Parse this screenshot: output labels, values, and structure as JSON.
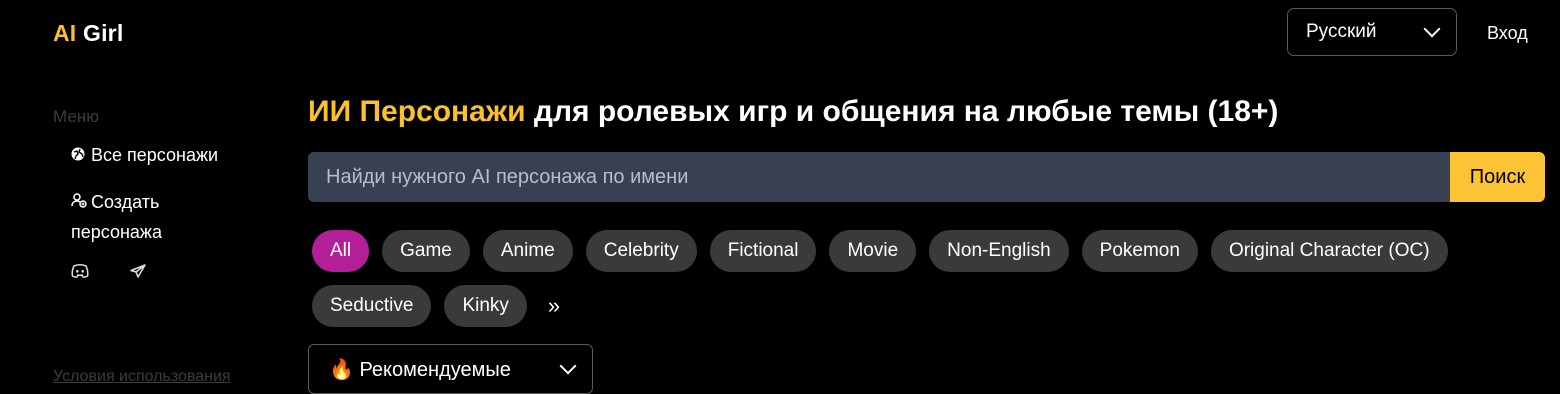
{
  "header": {
    "logo_accent": "AI",
    "logo_rest": " Girl",
    "language": "Русский",
    "login_label": "Вход"
  },
  "sidebar": {
    "menu_label": "Меню",
    "items": [
      {
        "label": "Все персонажи",
        "icon": "globe-icon"
      },
      {
        "label": "Создать персонажа",
        "icon": "user-add-icon"
      }
    ],
    "socials": [
      "discord-icon",
      "telegram-icon"
    ],
    "terms_label": "Условия использования"
  },
  "main": {
    "headline_accent": "ИИ Персонажи",
    "headline_rest": " для ролевых игр и общения на любые темы (18+)",
    "search_placeholder": "Найди нужного AI персонажа по имени",
    "search_button": "Поиск",
    "tags_row1": [
      "All",
      "Game",
      "Anime",
      "Celebrity",
      "Fictional",
      "Movie",
      "Non-English",
      "Pokemon",
      "Original Character (OC)"
    ],
    "tags_row2": [
      "Seductive",
      "Kinky"
    ],
    "active_tag": "All",
    "more_label": "»",
    "sort_icon": "🔥",
    "sort_label": "Рекомендуемые"
  },
  "colors": {
    "accent": "#fbc02d",
    "active_tag": "#b21f99",
    "tag_bg": "#3a3a3a",
    "search_bg": "#374151"
  }
}
